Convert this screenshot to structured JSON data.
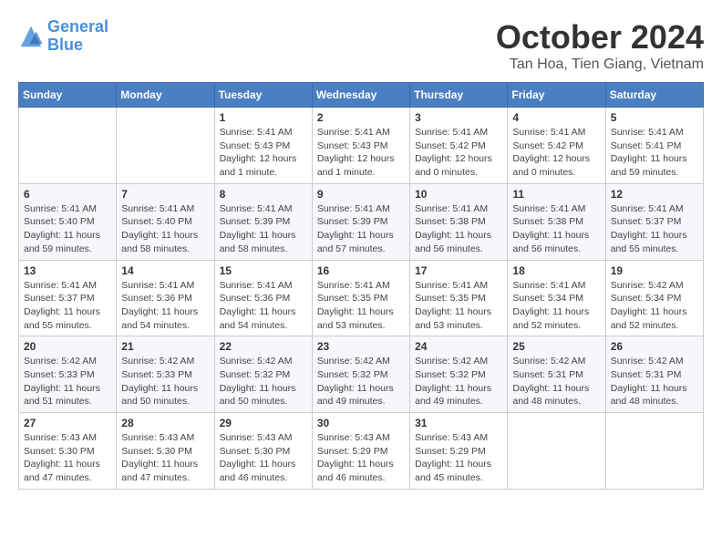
{
  "header": {
    "logo_line1": "General",
    "logo_line2": "Blue",
    "month": "October 2024",
    "location": "Tan Hoa, Tien Giang, Vietnam"
  },
  "weekdays": [
    "Sunday",
    "Monday",
    "Tuesday",
    "Wednesday",
    "Thursday",
    "Friday",
    "Saturday"
  ],
  "weeks": [
    [
      {
        "day": "",
        "sunrise": "",
        "sunset": "",
        "daylight": ""
      },
      {
        "day": "",
        "sunrise": "",
        "sunset": "",
        "daylight": ""
      },
      {
        "day": "1",
        "sunrise": "Sunrise: 5:41 AM",
        "sunset": "Sunset: 5:43 PM",
        "daylight": "Daylight: 12 hours and 1 minute."
      },
      {
        "day": "2",
        "sunrise": "Sunrise: 5:41 AM",
        "sunset": "Sunset: 5:43 PM",
        "daylight": "Daylight: 12 hours and 1 minute."
      },
      {
        "day": "3",
        "sunrise": "Sunrise: 5:41 AM",
        "sunset": "Sunset: 5:42 PM",
        "daylight": "Daylight: 12 hours and 0 minutes."
      },
      {
        "day": "4",
        "sunrise": "Sunrise: 5:41 AM",
        "sunset": "Sunset: 5:42 PM",
        "daylight": "Daylight: 12 hours and 0 minutes."
      },
      {
        "day": "5",
        "sunrise": "Sunrise: 5:41 AM",
        "sunset": "Sunset: 5:41 PM",
        "daylight": "Daylight: 11 hours and 59 minutes."
      }
    ],
    [
      {
        "day": "6",
        "sunrise": "Sunrise: 5:41 AM",
        "sunset": "Sunset: 5:40 PM",
        "daylight": "Daylight: 11 hours and 59 minutes."
      },
      {
        "day": "7",
        "sunrise": "Sunrise: 5:41 AM",
        "sunset": "Sunset: 5:40 PM",
        "daylight": "Daylight: 11 hours and 58 minutes."
      },
      {
        "day": "8",
        "sunrise": "Sunrise: 5:41 AM",
        "sunset": "Sunset: 5:39 PM",
        "daylight": "Daylight: 11 hours and 58 minutes."
      },
      {
        "day": "9",
        "sunrise": "Sunrise: 5:41 AM",
        "sunset": "Sunset: 5:39 PM",
        "daylight": "Daylight: 11 hours and 57 minutes."
      },
      {
        "day": "10",
        "sunrise": "Sunrise: 5:41 AM",
        "sunset": "Sunset: 5:38 PM",
        "daylight": "Daylight: 11 hours and 56 minutes."
      },
      {
        "day": "11",
        "sunrise": "Sunrise: 5:41 AM",
        "sunset": "Sunset: 5:38 PM",
        "daylight": "Daylight: 11 hours and 56 minutes."
      },
      {
        "day": "12",
        "sunrise": "Sunrise: 5:41 AM",
        "sunset": "Sunset: 5:37 PM",
        "daylight": "Daylight: 11 hours and 55 minutes."
      }
    ],
    [
      {
        "day": "13",
        "sunrise": "Sunrise: 5:41 AM",
        "sunset": "Sunset: 5:37 PM",
        "daylight": "Daylight: 11 hours and 55 minutes."
      },
      {
        "day": "14",
        "sunrise": "Sunrise: 5:41 AM",
        "sunset": "Sunset: 5:36 PM",
        "daylight": "Daylight: 11 hours and 54 minutes."
      },
      {
        "day": "15",
        "sunrise": "Sunrise: 5:41 AM",
        "sunset": "Sunset: 5:36 PM",
        "daylight": "Daylight: 11 hours and 54 minutes."
      },
      {
        "day": "16",
        "sunrise": "Sunrise: 5:41 AM",
        "sunset": "Sunset: 5:35 PM",
        "daylight": "Daylight: 11 hours and 53 minutes."
      },
      {
        "day": "17",
        "sunrise": "Sunrise: 5:41 AM",
        "sunset": "Sunset: 5:35 PM",
        "daylight": "Daylight: 11 hours and 53 minutes."
      },
      {
        "day": "18",
        "sunrise": "Sunrise: 5:41 AM",
        "sunset": "Sunset: 5:34 PM",
        "daylight": "Daylight: 11 hours and 52 minutes."
      },
      {
        "day": "19",
        "sunrise": "Sunrise: 5:42 AM",
        "sunset": "Sunset: 5:34 PM",
        "daylight": "Daylight: 11 hours and 52 minutes."
      }
    ],
    [
      {
        "day": "20",
        "sunrise": "Sunrise: 5:42 AM",
        "sunset": "Sunset: 5:33 PM",
        "daylight": "Daylight: 11 hours and 51 minutes."
      },
      {
        "day": "21",
        "sunrise": "Sunrise: 5:42 AM",
        "sunset": "Sunset: 5:33 PM",
        "daylight": "Daylight: 11 hours and 50 minutes."
      },
      {
        "day": "22",
        "sunrise": "Sunrise: 5:42 AM",
        "sunset": "Sunset: 5:32 PM",
        "daylight": "Daylight: 11 hours and 50 minutes."
      },
      {
        "day": "23",
        "sunrise": "Sunrise: 5:42 AM",
        "sunset": "Sunset: 5:32 PM",
        "daylight": "Daylight: 11 hours and 49 minutes."
      },
      {
        "day": "24",
        "sunrise": "Sunrise: 5:42 AM",
        "sunset": "Sunset: 5:32 PM",
        "daylight": "Daylight: 11 hours and 49 minutes."
      },
      {
        "day": "25",
        "sunrise": "Sunrise: 5:42 AM",
        "sunset": "Sunset: 5:31 PM",
        "daylight": "Daylight: 11 hours and 48 minutes."
      },
      {
        "day": "26",
        "sunrise": "Sunrise: 5:42 AM",
        "sunset": "Sunset: 5:31 PM",
        "daylight": "Daylight: 11 hours and 48 minutes."
      }
    ],
    [
      {
        "day": "27",
        "sunrise": "Sunrise: 5:43 AM",
        "sunset": "Sunset: 5:30 PM",
        "daylight": "Daylight: 11 hours and 47 minutes."
      },
      {
        "day": "28",
        "sunrise": "Sunrise: 5:43 AM",
        "sunset": "Sunset: 5:30 PM",
        "daylight": "Daylight: 11 hours and 47 minutes."
      },
      {
        "day": "29",
        "sunrise": "Sunrise: 5:43 AM",
        "sunset": "Sunset: 5:30 PM",
        "daylight": "Daylight: 11 hours and 46 minutes."
      },
      {
        "day": "30",
        "sunrise": "Sunrise: 5:43 AM",
        "sunset": "Sunset: 5:29 PM",
        "daylight": "Daylight: 11 hours and 46 minutes."
      },
      {
        "day": "31",
        "sunrise": "Sunrise: 5:43 AM",
        "sunset": "Sunset: 5:29 PM",
        "daylight": "Daylight: 11 hours and 45 minutes."
      },
      {
        "day": "",
        "sunrise": "",
        "sunset": "",
        "daylight": ""
      },
      {
        "day": "",
        "sunrise": "",
        "sunset": "",
        "daylight": ""
      }
    ]
  ]
}
